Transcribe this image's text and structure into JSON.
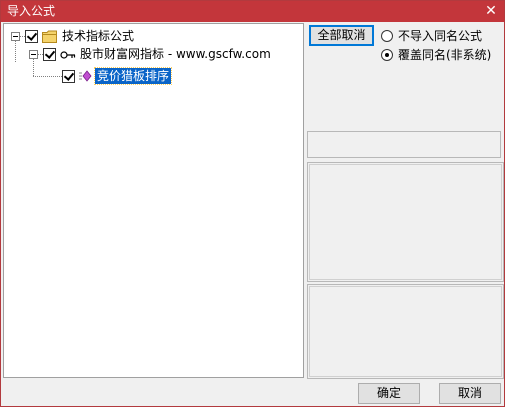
{
  "window": {
    "title": "导入公式",
    "close_glyph": "✕"
  },
  "tree": {
    "root": {
      "label": "技术指标公式",
      "checked": true,
      "icon": "folder-icon"
    },
    "child": {
      "label": "股市财富网指标 - www.gscfw.com",
      "checked": true,
      "icon": "key-icon"
    },
    "leaf": {
      "label": "竞价猎板排序",
      "checked": true,
      "selected": true,
      "icon": "formula-icon"
    }
  },
  "options": {
    "deselect_all_label": "全部取消",
    "radio_skip_label": "不导入同名公式",
    "radio_overwrite_label": "覆盖同名(非系统)",
    "selected": "overwrite"
  },
  "footer": {
    "ok_label": "确定",
    "cancel_label": "取消"
  },
  "colors": {
    "titlebar": "#c3363b",
    "selection": "#0a64c8"
  }
}
